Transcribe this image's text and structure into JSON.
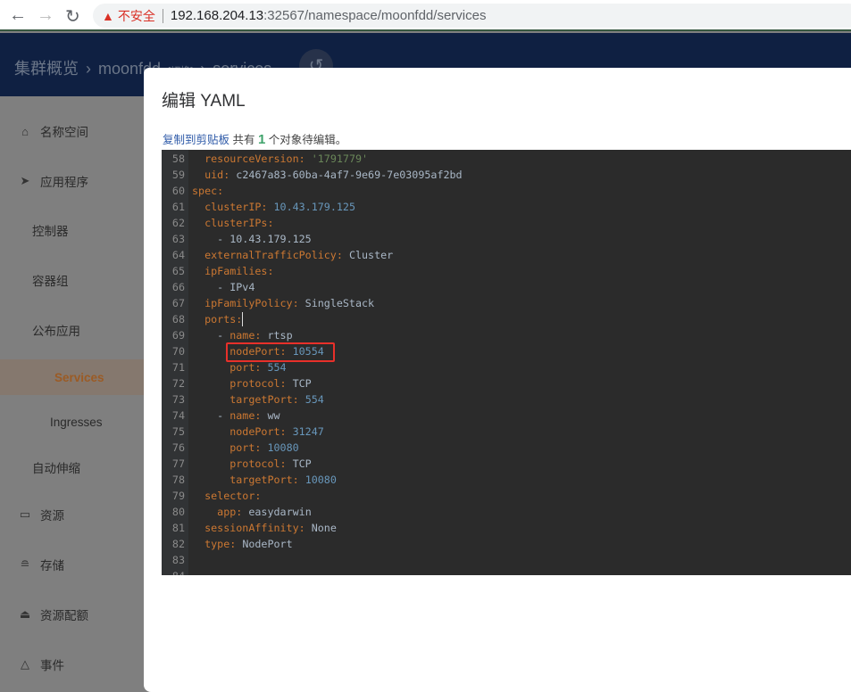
{
  "browser": {
    "warning_label": "不安全",
    "url_host": "192.168.204.13",
    "url_rest": ":32567/namespace/moonfdd/services"
  },
  "header": {
    "crumbs": [
      "集群概览",
      "moonfdd",
      "[切换]",
      "services"
    ]
  },
  "sidebar": {
    "items": [
      {
        "label": "名称空间",
        "icon": "home-icon"
      },
      {
        "label": "应用程序",
        "icon": "paper-plane-icon"
      },
      {
        "label": "控制器"
      },
      {
        "label": "容器组"
      },
      {
        "label": "公布应用"
      },
      {
        "label": "Services",
        "active": true
      },
      {
        "label": "Ingresses"
      },
      {
        "label": "自动伸缩"
      },
      {
        "label": "资源",
        "icon": "box-icon"
      },
      {
        "label": "存储",
        "icon": "database-icon"
      },
      {
        "label": "资源配额",
        "icon": "bell-icon"
      },
      {
        "label": "事件",
        "icon": "bell-outline-icon"
      }
    ]
  },
  "modal": {
    "title": "编辑 YAML",
    "copy_link": "复制到剪贴板",
    "info_pre": " 共有 ",
    "count": "1",
    "info_post": " 个对象待编辑。"
  },
  "colors": {
    "key": "#cc7832",
    "number": "#6897bb",
    "string": "#6a8759",
    "plain": "#a9b7c6",
    "highlight": "#e8302a"
  },
  "editor": {
    "lines": [
      {
        "n": "58",
        "t": [
          [
            "plain",
            "  "
          ],
          [
            "key",
            "resourceVersion"
          ],
          [
            "punc",
            ": "
          ],
          [
            "str",
            "'1791779'"
          ]
        ]
      },
      {
        "n": "59",
        "t": [
          [
            "plain",
            "  "
          ],
          [
            "key",
            "uid"
          ],
          [
            "punc",
            ": "
          ],
          [
            "plain",
            "c2467a83-60ba-4af7-9e69-7e03095af2bd"
          ]
        ]
      },
      {
        "n": "60",
        "t": [
          [
            "key",
            "spec"
          ],
          [
            "punc",
            ":"
          ]
        ]
      },
      {
        "n": "61",
        "t": [
          [
            "plain",
            "  "
          ],
          [
            "key",
            "clusterIP"
          ],
          [
            "punc",
            ": "
          ],
          [
            "num",
            "10.43.179.125"
          ]
        ]
      },
      {
        "n": "62",
        "t": [
          [
            "plain",
            "  "
          ],
          [
            "key",
            "clusterIPs"
          ],
          [
            "punc",
            ":"
          ]
        ]
      },
      {
        "n": "63",
        "t": [
          [
            "plain",
            "    - 10.43.179.125"
          ]
        ]
      },
      {
        "n": "64",
        "t": [
          [
            "plain",
            "  "
          ],
          [
            "key",
            "externalTrafficPolicy"
          ],
          [
            "punc",
            ": "
          ],
          [
            "plain",
            "Cluster"
          ]
        ]
      },
      {
        "n": "65",
        "t": [
          [
            "plain",
            "  "
          ],
          [
            "key",
            "ipFamilies"
          ],
          [
            "punc",
            ":"
          ]
        ]
      },
      {
        "n": "66",
        "t": [
          [
            "plain",
            "    - IPv4"
          ]
        ]
      },
      {
        "n": "67",
        "t": [
          [
            "plain",
            "  "
          ],
          [
            "key",
            "ipFamilyPolicy"
          ],
          [
            "punc",
            ": "
          ],
          [
            "plain",
            "SingleStack"
          ]
        ]
      },
      {
        "n": "68",
        "t": [
          [
            "plain",
            "  "
          ],
          [
            "key",
            "ports"
          ],
          [
            "punc",
            ":"
          ]
        ]
      },
      {
        "n": "69",
        "t": [
          [
            "plain",
            "    - "
          ],
          [
            "key",
            "name"
          ],
          [
            "punc",
            ": "
          ],
          [
            "plain",
            "rtsp"
          ]
        ]
      },
      {
        "n": "70",
        "t": [
          [
            "plain",
            "      "
          ],
          [
            "key",
            "nodePort"
          ],
          [
            "punc",
            ": "
          ],
          [
            "num",
            "10554"
          ]
        ]
      },
      {
        "n": "71",
        "t": [
          [
            "plain",
            "      "
          ],
          [
            "key",
            "port"
          ],
          [
            "punc",
            ": "
          ],
          [
            "num",
            "554"
          ]
        ]
      },
      {
        "n": "72",
        "t": [
          [
            "plain",
            "      "
          ],
          [
            "key",
            "protocol"
          ],
          [
            "punc",
            ": "
          ],
          [
            "plain",
            "TCP"
          ]
        ]
      },
      {
        "n": "73",
        "t": [
          [
            "plain",
            "      "
          ],
          [
            "key",
            "targetPort"
          ],
          [
            "punc",
            ": "
          ],
          [
            "num",
            "554"
          ]
        ]
      },
      {
        "n": "74",
        "t": [
          [
            "plain",
            "    - "
          ],
          [
            "key",
            "name"
          ],
          [
            "punc",
            ": "
          ],
          [
            "plain",
            "ww"
          ]
        ]
      },
      {
        "n": "75",
        "t": [
          [
            "plain",
            "      "
          ],
          [
            "key",
            "nodePort"
          ],
          [
            "punc",
            ": "
          ],
          [
            "num",
            "31247"
          ]
        ]
      },
      {
        "n": "76",
        "t": [
          [
            "plain",
            "      "
          ],
          [
            "key",
            "port"
          ],
          [
            "punc",
            ": "
          ],
          [
            "num",
            "10080"
          ]
        ]
      },
      {
        "n": "77",
        "t": [
          [
            "plain",
            "      "
          ],
          [
            "key",
            "protocol"
          ],
          [
            "punc",
            ": "
          ],
          [
            "plain",
            "TCP"
          ]
        ]
      },
      {
        "n": "78",
        "t": [
          [
            "plain",
            "      "
          ],
          [
            "key",
            "targetPort"
          ],
          [
            "punc",
            ": "
          ],
          [
            "num",
            "10080"
          ]
        ]
      },
      {
        "n": "79",
        "t": [
          [
            "plain",
            "  "
          ],
          [
            "key",
            "selector"
          ],
          [
            "punc",
            ":"
          ]
        ]
      },
      {
        "n": "80",
        "t": [
          [
            "plain",
            "    "
          ],
          [
            "key",
            "app"
          ],
          [
            "punc",
            ": "
          ],
          [
            "plain",
            "easydarwin"
          ]
        ]
      },
      {
        "n": "81",
        "t": [
          [
            "plain",
            "  "
          ],
          [
            "key",
            "sessionAffinity"
          ],
          [
            "punc",
            ": "
          ],
          [
            "plain",
            "None"
          ]
        ]
      },
      {
        "n": "82",
        "t": [
          [
            "plain",
            "  "
          ],
          [
            "key",
            "type"
          ],
          [
            "punc",
            ": "
          ],
          [
            "plain",
            "NodePort"
          ]
        ]
      },
      {
        "n": "83",
        "t": []
      },
      {
        "n": "84",
        "t": []
      }
    ]
  }
}
